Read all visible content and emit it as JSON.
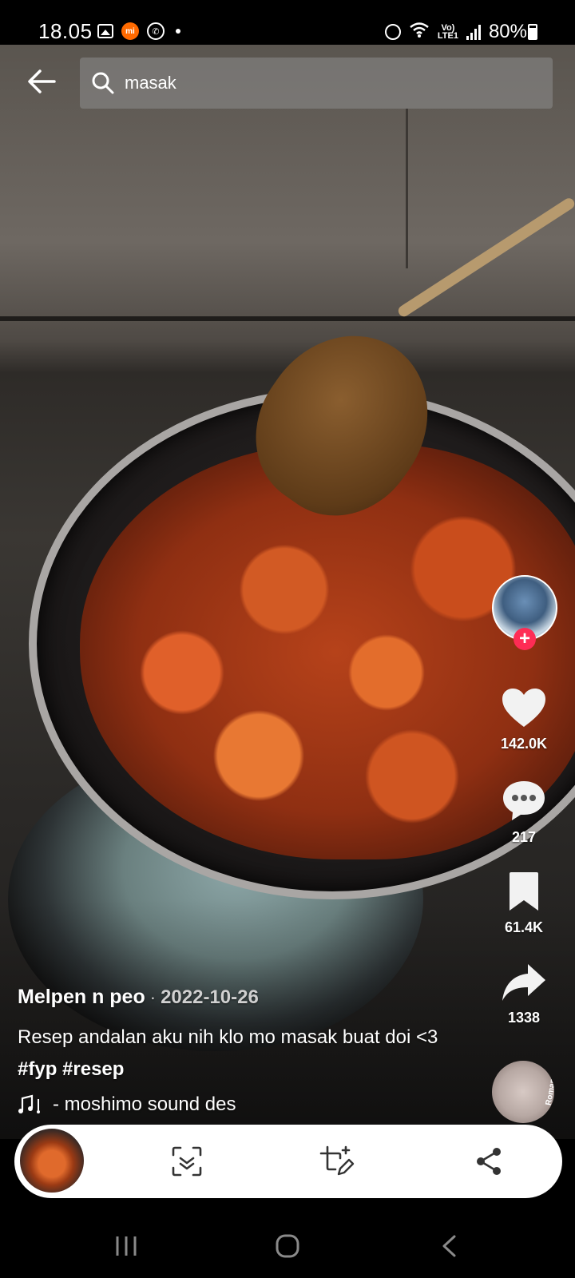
{
  "status_bar": {
    "time": "18.05",
    "battery": "80%",
    "network": "LTE1",
    "volte": "Vo)"
  },
  "search": {
    "query": "masak"
  },
  "video": {
    "author": "Melpen n peo",
    "separator": "·",
    "date": "2022-10-26",
    "description": "Resep andalan aku nih klo mo masak buat doi <3",
    "hashtags": [
      "#fyp",
      "#resep"
    ],
    "music": "- moshimo sound des"
  },
  "actions": {
    "likes": "142.0K",
    "comments": "217",
    "saves": "61.4K",
    "shares": "1338",
    "disc_label": "Romantic",
    "follow_label": "+"
  },
  "colors": {
    "accent": "#fe2c55",
    "toolbar_bg": "#ffffff",
    "search_bg": "#8c8c8c"
  }
}
